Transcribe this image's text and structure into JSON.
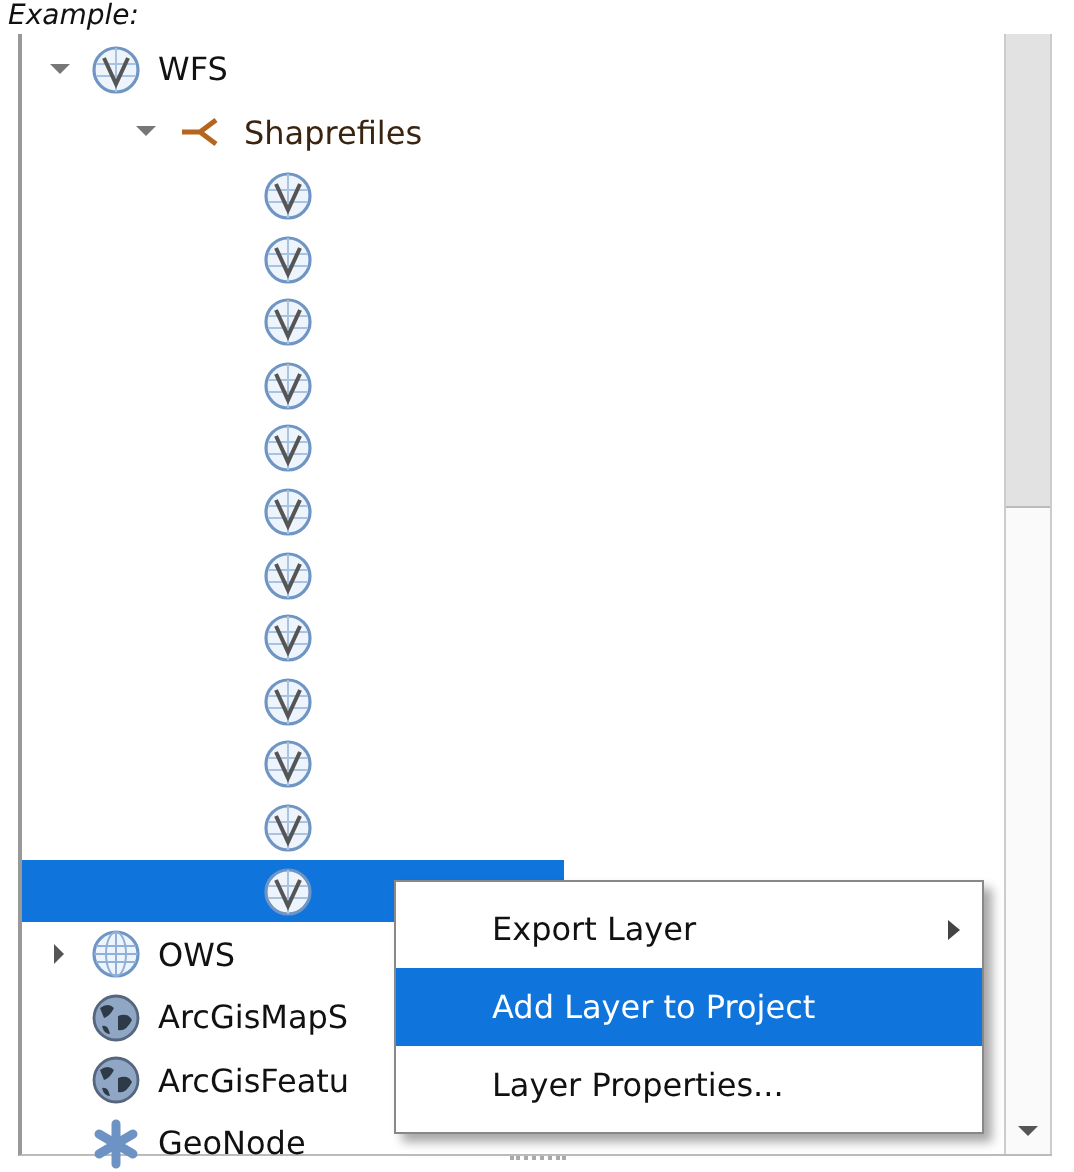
{
  "caption": "Example:",
  "tree": [
    {
      "kind": "wfs",
      "label": "WFS",
      "expanded": true,
      "selected": false,
      "children": [
        {
          "kind": "connection",
          "label": "Shaprefiles",
          "expanded": true,
          "selected": false,
          "children": [
            {
              "kind": "vector-layer",
              "selected": false
            },
            {
              "kind": "vector-layer",
              "selected": false
            },
            {
              "kind": "vector-layer",
              "selected": false
            },
            {
              "kind": "vector-layer",
              "selected": false
            },
            {
              "kind": "vector-layer",
              "selected": false
            },
            {
              "kind": "vector-layer",
              "selected": false
            },
            {
              "kind": "vector-layer",
              "selected": false
            },
            {
              "kind": "vector-layer",
              "selected": false
            },
            {
              "kind": "vector-layer",
              "selected": false
            },
            {
              "kind": "vector-layer",
              "selected": false
            },
            {
              "kind": "vector-layer",
              "selected": false
            },
            {
              "kind": "vector-layer",
              "selected": true
            }
          ]
        }
      ]
    },
    {
      "kind": "ows",
      "label": "OWS",
      "expanded": false,
      "selected": false
    },
    {
      "kind": "arcgis",
      "label": "ArcGisMapS",
      "selected": false
    },
    {
      "kind": "arcgis",
      "label": "ArcGisFeatu",
      "selected": false
    },
    {
      "kind": "geonode",
      "label": "GeoNode",
      "selected": false
    }
  ],
  "context_menu": [
    {
      "label": "Export Layer",
      "submenu": true,
      "selected": false
    },
    {
      "label": "Add Layer to Project",
      "submenu": false,
      "selected": true
    },
    {
      "label": "Layer Properties...",
      "submenu": false,
      "selected": false
    }
  ]
}
